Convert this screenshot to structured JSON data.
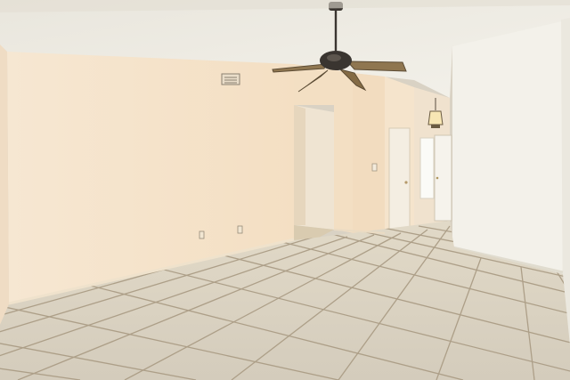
{
  "scene": {
    "subject": "empty-room-interior",
    "fixtures": [
      "ceiling-fan",
      "pendant-light",
      "hvac-vent",
      "doorway",
      "front-door",
      "window",
      "electrical-outlet",
      "light-switch"
    ],
    "colors": {
      "ceiling": "#f1efe6",
      "wall_warm": "#f6e6cf",
      "wall_shadow": "#efdcc2",
      "wall_right": "#f2f0e9",
      "floor_tile": "#dcd5c6",
      "grout": "#a89d8a",
      "fan_metal": "#3a3530",
      "fan_blade": "#8f7650",
      "door": "#f3efe4",
      "baseboard": "#ece2d0"
    }
  }
}
